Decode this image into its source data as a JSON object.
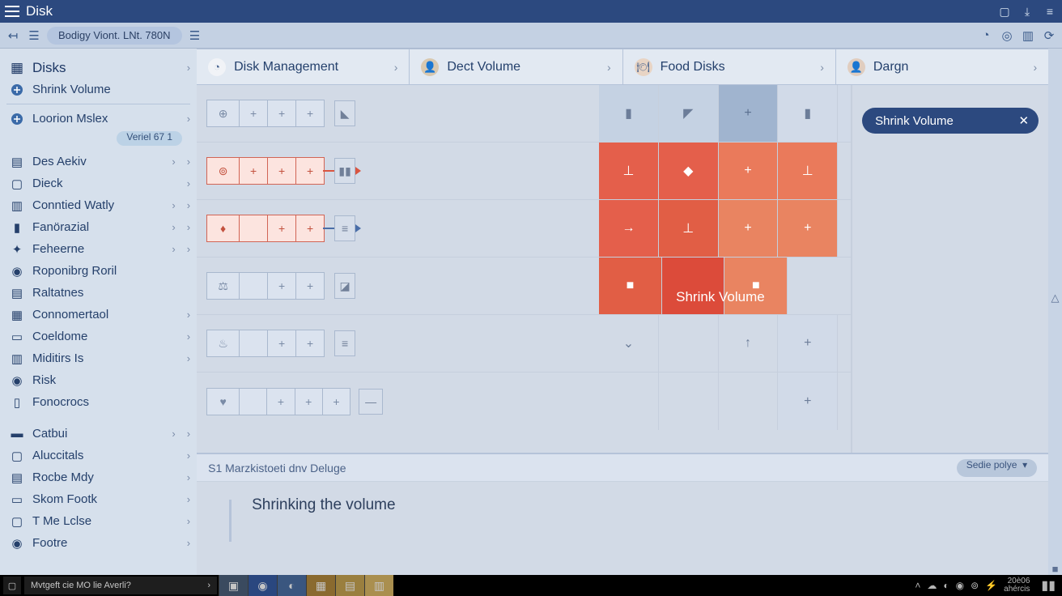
{
  "titlebar": {
    "title": "Disk"
  },
  "toolbar": {
    "chip": "Bodigy Viont. LNt.   780N"
  },
  "sidebar": {
    "head": "Disks",
    "shrink": "Shrink Volume",
    "item2": "Loorion Mslex",
    "badge": "Veriel 67 1",
    "items": [
      "Des Aekiv",
      "Dieck",
      "Conntied Watly",
      "Fanörazial",
      "Feheerne",
      "Roponibrg Roril",
      "Raltatnes",
      "Connomertaol",
      "Coeldome",
      "Miditirs Is",
      "Risk",
      "Fonocrocs"
    ],
    "items2": [
      "Catbui",
      "Aluccitals",
      "Rocbe Mdy",
      "Skom Footk",
      "T Me Lclse",
      "Footre"
    ]
  },
  "columns": [
    "Disk Management",
    "Dect Volume",
    "Food Disks",
    "Dargn"
  ],
  "tag": "Shrink Volume",
  "shrink_label": "Shrink Volume",
  "bottom": {
    "header": "S1   Marzkistoeti dnv Deluge",
    "chip": "Sedie polye",
    "text": "Shrinking the volume"
  },
  "taskbar": {
    "search": "Mvtgeft cie MO lie Averli?",
    "clock1": "20è06",
    "clock2": "ahércis"
  }
}
